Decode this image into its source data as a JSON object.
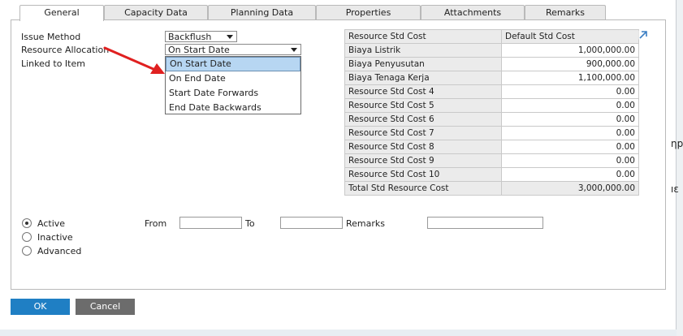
{
  "tabs": [
    {
      "label": "General",
      "active": true
    },
    {
      "label": "Capacity Data",
      "active": false
    },
    {
      "label": "Planning Data",
      "active": false
    },
    {
      "label": "Properties",
      "active": false
    },
    {
      "label": "Attachments",
      "active": false
    },
    {
      "label": "Remarks",
      "active": false
    }
  ],
  "fields": {
    "issue_method_label": "Issue Method",
    "issue_method_value": "Backflush",
    "resource_allocation_label": "Resource Allocation",
    "resource_allocation_value": "On Start Date",
    "linked_to_item_label": "Linked to Item"
  },
  "dropdown": {
    "options": [
      "On Start Date",
      "On End Date",
      "Start Date Forwards",
      "End Date Backwards"
    ],
    "selected_index": 0
  },
  "cost_table": {
    "headers": [
      "Resource Std Cost",
      "Default Std Cost"
    ],
    "rows": [
      {
        "name": "Biaya Listrik",
        "value": "1,000,000.00"
      },
      {
        "name": "Biaya Penyusutan",
        "value": "900,000.00"
      },
      {
        "name": "Biaya Tenaga Kerja",
        "value": "1,100,000.00"
      },
      {
        "name": "Resource Std Cost 4",
        "value": "0.00"
      },
      {
        "name": "Resource Std Cost 5",
        "value": "0.00"
      },
      {
        "name": "Resource Std Cost 6",
        "value": "0.00"
      },
      {
        "name": "Resource Std Cost 7",
        "value": "0.00"
      },
      {
        "name": "Resource Std Cost 8",
        "value": "0.00"
      },
      {
        "name": "Resource Std Cost 9",
        "value": "0.00"
      },
      {
        "name": "Resource Std Cost 10",
        "value": "0.00"
      }
    ],
    "total": {
      "name": "Total Std Resource Cost",
      "value": "3,000,000.00"
    }
  },
  "status": {
    "active_label": "Active",
    "inactive_label": "Inactive",
    "advanced_label": "Advanced",
    "selected": "Active",
    "from_label": "From",
    "to_label": "To",
    "remarks_label": "Remarks"
  },
  "buttons": {
    "ok": "OK",
    "cancel": "Cancel"
  },
  "background_clip": {
    "line1": "ηp",
    "line2": "ıε"
  },
  "colors": {
    "ok_button": "#1f7fc4",
    "cancel_button": "#6c6c6c",
    "arrow": "#e02020",
    "selected_option": "#b7d6f2"
  },
  "icons": {
    "expand": "expand-arrow-icon",
    "annotation": "red-arrow-icon"
  }
}
